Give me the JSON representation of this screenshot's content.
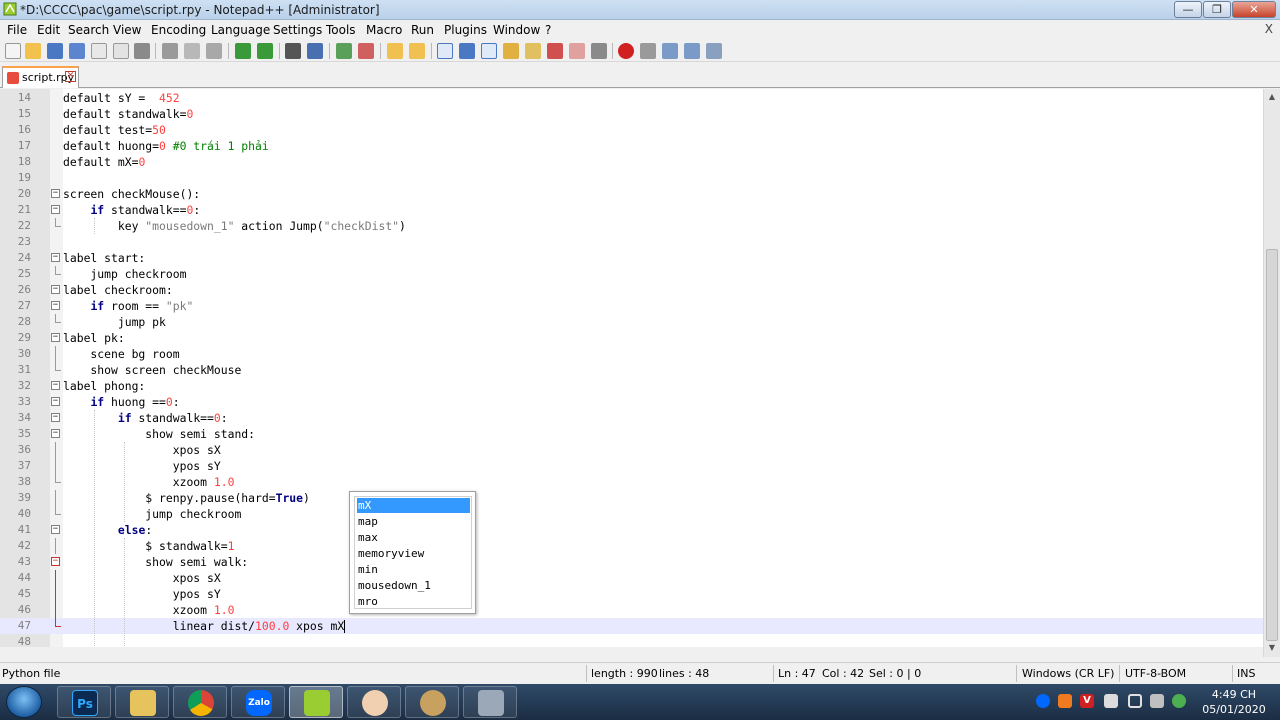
{
  "window": {
    "title": "*D:\\CCCC\\pac\\game\\script.rpy - Notepad++ [Administrator]",
    "min_glyph": "—",
    "max_glyph": "❐",
    "close_glyph": "✕"
  },
  "menu": {
    "items": [
      "File",
      "Edit",
      "Search",
      "View",
      "Encoding",
      "Language",
      "Settings",
      "Tools",
      "Macro",
      "Run",
      "Plugins",
      "Window",
      "?"
    ],
    "close_doc": "X"
  },
  "tab": {
    "label": "script.rpy",
    "close_glyph": "✕"
  },
  "editor": {
    "current_line": 47,
    "lines": [
      {
        "n": "14"
      },
      {
        "n": "15"
      },
      {
        "n": "16"
      },
      {
        "n": "17"
      },
      {
        "n": "18"
      },
      {
        "n": "19"
      },
      {
        "n": "20"
      },
      {
        "n": "21"
      },
      {
        "n": "22"
      },
      {
        "n": "23"
      },
      {
        "n": "24"
      },
      {
        "n": "25"
      },
      {
        "n": "26"
      },
      {
        "n": "27"
      },
      {
        "n": "28"
      },
      {
        "n": "29"
      },
      {
        "n": "30"
      },
      {
        "n": "31"
      },
      {
        "n": "32"
      },
      {
        "n": "33"
      },
      {
        "n": "34"
      },
      {
        "n": "35"
      },
      {
        "n": "36"
      },
      {
        "n": "37"
      },
      {
        "n": "38"
      },
      {
        "n": "39"
      },
      {
        "n": "40"
      },
      {
        "n": "41"
      },
      {
        "n": "42"
      },
      {
        "n": "43"
      },
      {
        "n": "44"
      },
      {
        "n": "45"
      },
      {
        "n": "46"
      },
      {
        "n": "47"
      },
      {
        "n": "48"
      }
    ],
    "tokens": {
      "l14a": "default sY =  ",
      "l14b": "452",
      "l15a": "default standwalk=",
      "l15b": "0",
      "l16a": "default test=",
      "l16b": "50",
      "l17a": "default huong=",
      "l17b": "0",
      "l17c": " #0 trái 1 phải",
      "l18a": "default mX=",
      "l18b": "0",
      "l20a": "screen checkMouse():",
      "l21a": "    ",
      "l21b": "if",
      "l21c": " standwalk==",
      "l21d": "0",
      "l21e": ":",
      "l22a": "        key ",
      "l22b": "\"mousedown_1\"",
      "l22c": " action Jump(",
      "l22d": "\"checkDist\"",
      "l22e": ")",
      "l24a": "label start:",
      "l25a": "    jump checkroom",
      "l26a": "label checkroom:",
      "l27a": "    ",
      "l27b": "if",
      "l27c": " room == ",
      "l27d": "\"pk\"",
      "l28a": "        jump pk",
      "l29a": "label pk:",
      "l30a": "    scene bg room",
      "l31a": "    show screen checkMouse",
      "l32a": "label phong:",
      "l33a": "    ",
      "l33b": "if",
      "l33c": " huong ==",
      "l33d": "0",
      "l33e": ":",
      "l34a": "        ",
      "l34b": "if",
      "l34c": " standwalk==",
      "l34d": "0",
      "l34e": ":",
      "l35a": "            show semi stand:",
      "l36a": "                xpos sX",
      "l37a": "                ypos sY",
      "l38a": "                xzoom ",
      "l38b": "1.0",
      "l39a": "            $ renpy.pause(hard=",
      "l39b": "True",
      "l39c": ")",
      "l40a": "            jump checkroom",
      "l41a": "        ",
      "l41b": "else",
      "l41c": ":",
      "l42a": "            $ standwalk=",
      "l42b": "1",
      "l43a": "            show semi walk:",
      "l44a": "                xpos sX",
      "l45a": "                ypos sY",
      "l46a": "                xzoom ",
      "l46b": "1.0",
      "l47a": "                linear dist/",
      "l47b": "100.0",
      "l47c": " xpos mX"
    }
  },
  "autocomplete": {
    "selected": "mX",
    "items": [
      "mX",
      "map",
      "max",
      "memoryview",
      "min",
      "mousedown_1",
      "mro"
    ]
  },
  "statusbar": {
    "language": "Python file",
    "length": "length : 990",
    "lines": "lines : 48",
    "ln": "Ln : 47",
    "col": "Col : 42",
    "sel": "Sel : 0 | 0",
    "eol": "Windows (CR LF)",
    "encoding": "UTF-8-BOM",
    "mode": "INS"
  },
  "taskbar": {
    "ps_label": "Ps",
    "zalo_label": "Zalo",
    "clock_time": "4:49 CH",
    "clock_date": "05/01/2020",
    "tray_v": "V"
  },
  "colors": {
    "keyword": "#000080",
    "number": "#ff4040",
    "string": "#7a7a7a",
    "comment": "#008000",
    "selection": "#3399ff",
    "current_line": "#e8e8ff"
  }
}
